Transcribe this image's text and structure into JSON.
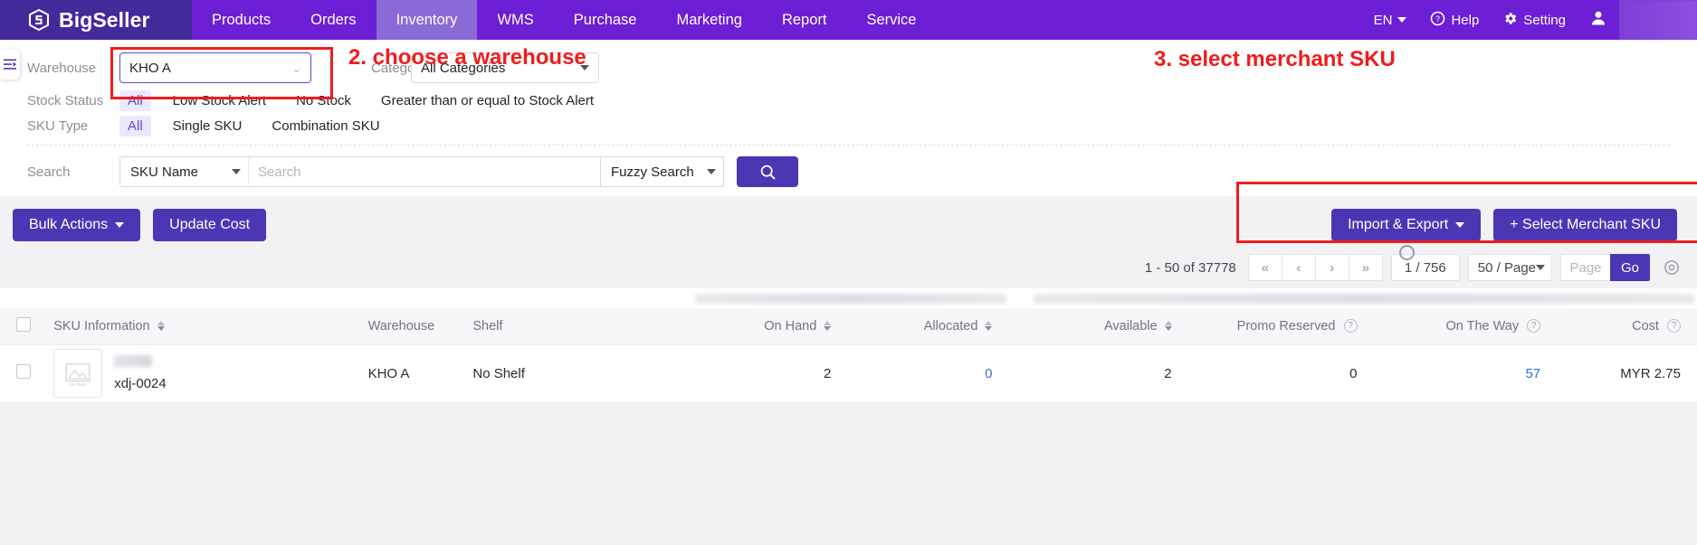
{
  "nav": {
    "brand": "BigSeller",
    "items": [
      {
        "label": "Products",
        "active": false
      },
      {
        "label": "Orders",
        "active": false
      },
      {
        "label": "Inventory",
        "active": true
      },
      {
        "label": "WMS",
        "active": false
      },
      {
        "label": "Purchase",
        "active": false
      },
      {
        "label": "Marketing",
        "active": false
      },
      {
        "label": "Report",
        "active": false
      },
      {
        "label": "Service",
        "active": false
      }
    ],
    "lang": "EN",
    "help": "Help",
    "setting": "Setting"
  },
  "filters": {
    "warehouse_label": "Warehouse",
    "warehouse_value": "KHO A",
    "category_label": "Category",
    "category_value": "All Categories",
    "stock_status_label": "Stock Status",
    "stock_status_options": [
      {
        "label": "All",
        "active": true
      },
      {
        "label": "Low Stock Alert",
        "active": false
      },
      {
        "label": "No Stock",
        "active": false
      },
      {
        "label": "Greater than or equal to Stock Alert",
        "active": false
      }
    ],
    "sku_type_label": "SKU Type",
    "sku_type_options": [
      {
        "label": "All",
        "active": true
      },
      {
        "label": "Single SKU",
        "active": false
      },
      {
        "label": "Combination SKU",
        "active": false
      }
    ],
    "search_label": "Search",
    "search_field": "SKU Name",
    "search_placeholder": "Search",
    "search_value": "",
    "search_mode": "Fuzzy Search"
  },
  "annotations": {
    "step2": "2. choose a warehouse",
    "step3": "3. select merchant SKU"
  },
  "actions": {
    "bulk_actions": "Bulk Actions",
    "update_cost": "Update Cost",
    "import_export": "Import & Export",
    "select_merchant_sku": "+ Select Merchant SKU"
  },
  "pagination": {
    "range": "1 - 50 of 37778",
    "first": "«",
    "prev": "‹",
    "next": "›",
    "last": "»",
    "current": "1 / 756",
    "page_size": "50 / Page",
    "page_placeholder": "Page",
    "go": "Go"
  },
  "table": {
    "columns": [
      {
        "label": "SKU Information",
        "sortable": true,
        "align": "left"
      },
      {
        "label": "Warehouse",
        "sortable": false,
        "align": "left"
      },
      {
        "label": "Shelf",
        "sortable": false,
        "align": "left"
      },
      {
        "label": "On Hand",
        "sortable": true,
        "align": "right"
      },
      {
        "label": "Allocated",
        "sortable": true,
        "align": "right"
      },
      {
        "label": "Available",
        "sortable": true,
        "align": "right"
      },
      {
        "label": "Promo Reserved",
        "sortable": false,
        "help": true,
        "align": "right"
      },
      {
        "label": "On The Way",
        "sortable": false,
        "help": true,
        "align": "right"
      },
      {
        "label": "Cost",
        "sortable": false,
        "help": true,
        "align": "right"
      }
    ],
    "rows": [
      {
        "sku_code": "xdj-0024",
        "warehouse": "KHO A",
        "shelf": "No Shelf",
        "on_hand": "2",
        "allocated": "0",
        "available": "2",
        "promo_reserved": "0",
        "on_the_way": "57",
        "cost": "MYR 2.75"
      }
    ]
  },
  "colors": {
    "brand_dark": "#432a9b",
    "brand_purple": "#6c1fd4",
    "button_purple": "#4b37b3",
    "annotation_red": "#f01c1c",
    "link_blue": "#3a6ed6"
  }
}
